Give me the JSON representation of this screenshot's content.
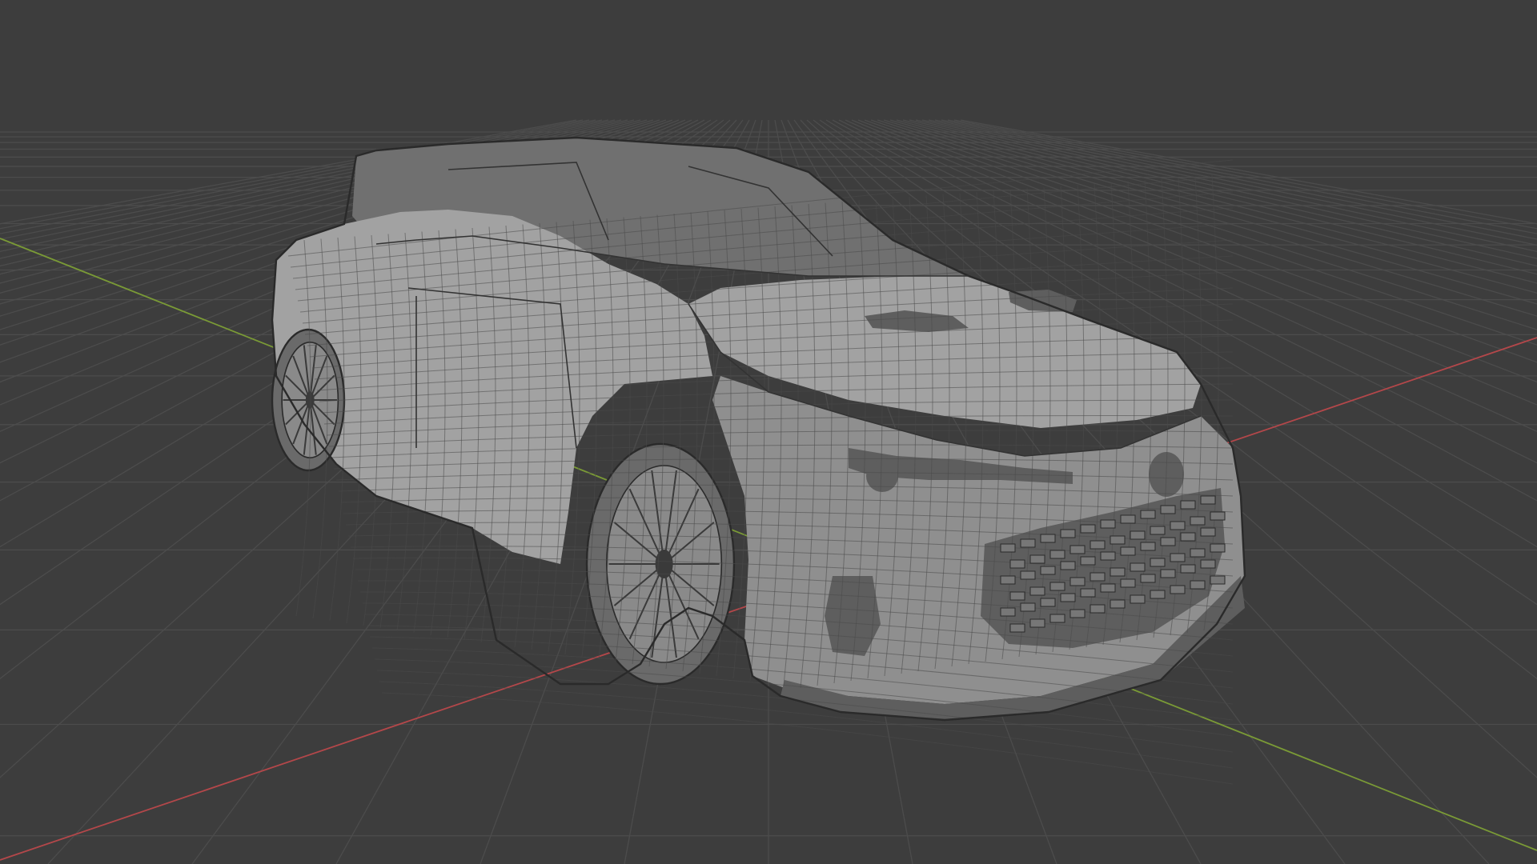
{
  "viewport": {
    "background_color": "#3d3d3d",
    "grid_color": "#4c4c4c",
    "x_axis_color": "#b3474a",
    "y_axis_color": "#7a9a36",
    "mesh_color": "#a2a2a2",
    "wire_color": "#2a2a2a"
  },
  "model": {
    "icon": "car-wireframe-icon"
  }
}
